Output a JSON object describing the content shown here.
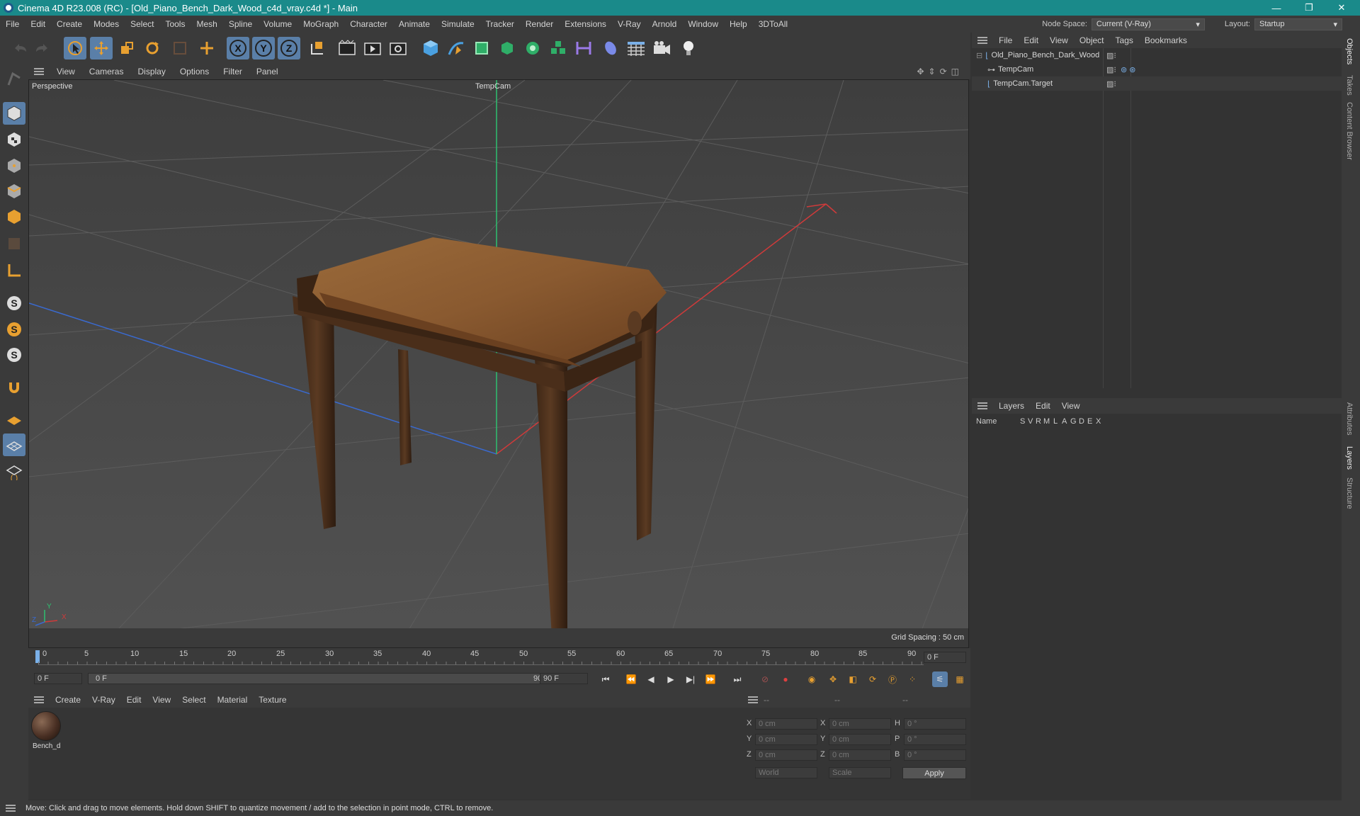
{
  "window": {
    "title": "Cinema 4D R23.008 (RC) - [Old_Piano_Bench_Dark_Wood_c4d_vray.c4d *] - Main",
    "minimize": "—",
    "restore": "❐",
    "close": "✕"
  },
  "menubar": {
    "items": [
      "File",
      "Edit",
      "Create",
      "Modes",
      "Select",
      "Tools",
      "Mesh",
      "Spline",
      "Volume",
      "MoGraph",
      "Character",
      "Animate",
      "Simulate",
      "Tracker",
      "Render",
      "Extensions",
      "V-Ray",
      "Arnold",
      "Window",
      "Help",
      "3DToAll"
    ],
    "node_space_label": "Node Space:",
    "node_space_value": "Current (V-Ray)",
    "layout_label": "Layout:",
    "layout_value": "Startup"
  },
  "viewport": {
    "menu": [
      "View",
      "Cameras",
      "Display",
      "Options",
      "Filter",
      "Panel"
    ],
    "label": "Perspective",
    "camera": "TempCam",
    "grid_spacing": "Grid Spacing : 50 cm",
    "axis_y": "Y",
    "axis_z": "Z",
    "axis_x": "X"
  },
  "timeline": {
    "ticks": [
      "0",
      "5",
      "10",
      "15",
      "20",
      "25",
      "30",
      "35",
      "40",
      "45",
      "50",
      "55",
      "60",
      "65",
      "70",
      "75",
      "80",
      "85",
      "90"
    ],
    "current_frame_right": "0 F"
  },
  "playbar": {
    "start_frame": "0 F",
    "range_start": "0 F",
    "range_end": "90 F",
    "end_frame": "90 F"
  },
  "material_panel": {
    "menu": [
      "Create",
      "V-Ray",
      "Edit",
      "View",
      "Select",
      "Material",
      "Texture"
    ],
    "material_name": "Bench_d"
  },
  "coord_panel": {
    "headers": [
      "--",
      "--",
      "--"
    ],
    "rows": [
      {
        "l1": "X",
        "v1": "0 cm",
        "l2": "X",
        "v2": "0 cm",
        "l3": "H",
        "v3": "0 °"
      },
      {
        "l1": "Y",
        "v1": "0 cm",
        "l2": "Y",
        "v2": "0 cm",
        "l3": "P",
        "v3": "0 °"
      },
      {
        "l1": "Z",
        "v1": "0 cm",
        "l2": "Z",
        "v2": "0 cm",
        "l3": "B",
        "v3": "0 °"
      }
    ],
    "world": "World",
    "scale": "Scale",
    "apply": "Apply"
  },
  "object_manager": {
    "menu": [
      "File",
      "Edit",
      "View",
      "Object",
      "Tags",
      "Bookmarks"
    ],
    "objects": [
      "Old_Piano_Bench_Dark_Wood",
      "TempCam",
      "TempCam.Target"
    ]
  },
  "layers": {
    "menu": [
      "Layers",
      "Edit",
      "View"
    ],
    "columns": "Name",
    "flags": [
      "S",
      "V",
      "R",
      "M",
      "L",
      "A",
      "G",
      "D",
      "E",
      "X"
    ]
  },
  "right_tabs": [
    "Objects",
    "Takes",
    "Content Browser",
    "Attributes",
    "Layers",
    "Structure"
  ],
  "status": "Move: Click and drag to move elements. Hold down SHIFT to quantize movement / add to the selection in point mode, CTRL to remove."
}
